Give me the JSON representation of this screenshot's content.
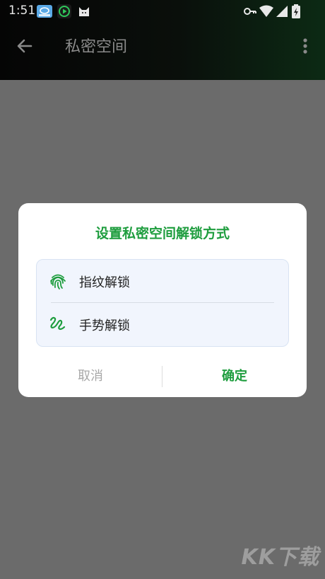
{
  "status_bar": {
    "time": "1:51",
    "left_icons": [
      "app-badge-icon",
      "play-circle-icon",
      "cat-icon"
    ],
    "right_icons": [
      "key-icon",
      "wifi-icon",
      "signal-icon",
      "battery-icon"
    ]
  },
  "toolbar": {
    "title": "私密空间",
    "back_icon": "arrow-back-icon",
    "menu_icon": "more-vert-icon"
  },
  "dialog": {
    "title": "设置私密空间解锁方式",
    "options": [
      {
        "label": "指纹解锁",
        "icon": "fingerprint-icon"
      },
      {
        "label": "手势解锁",
        "icon": "gesture-icon"
      }
    ],
    "cancel_label": "取消",
    "confirm_label": "确定"
  },
  "watermark": "KK下载",
  "colors": {
    "accent": "#1e9d3e",
    "scrim": "#6b6b6b",
    "dialog_bg": "#ffffff",
    "options_bg": "#f1f5fd"
  }
}
